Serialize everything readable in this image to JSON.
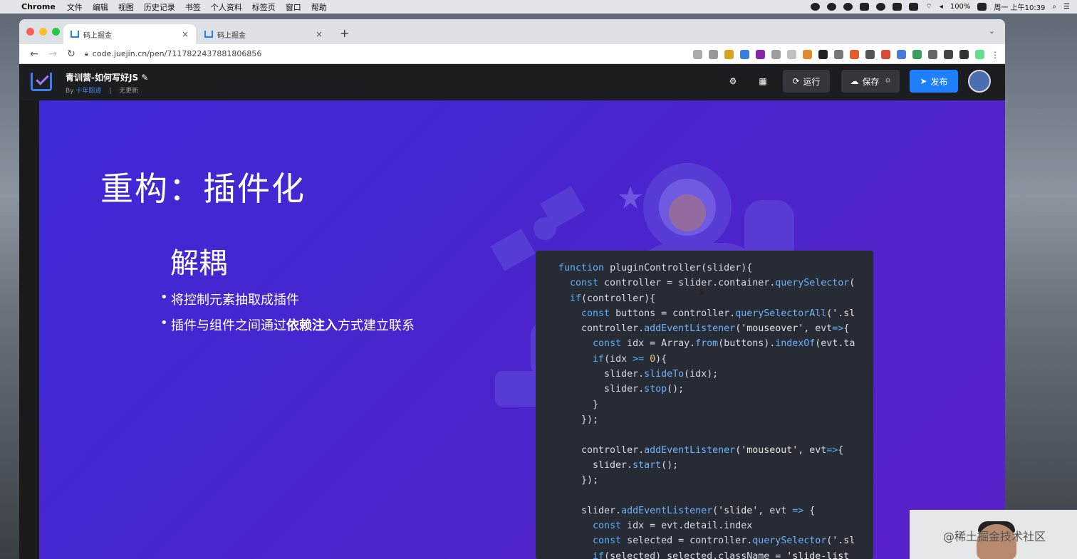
{
  "menubar": {
    "app": "Chrome",
    "items": [
      "文件",
      "编辑",
      "视图",
      "历史记录",
      "书签",
      "个人资料",
      "标签页",
      "窗口",
      "帮助"
    ],
    "battery": "100%",
    "clock": "周一 上午10:39"
  },
  "browser": {
    "tabs": [
      {
        "title": "码上掘金",
        "active": true
      },
      {
        "title": "码上掘金",
        "active": false
      }
    ],
    "url": "code.juejin.cn/pen/7117822437881806856"
  },
  "app": {
    "project_title": "青训营-如何写好JS",
    "by_label": "By",
    "author": "十年踪迹",
    "separator": "|",
    "update_status": "无更新",
    "run_label": "运行",
    "save_label": "保存",
    "publish_label": "发布"
  },
  "slide": {
    "title": "重构：插件化",
    "subtitle": "解耦",
    "bullet1": "将控制元素抽取成插件",
    "bullet2_pre": "插件与组件之间通过",
    "bullet2_bold": "依赖注入",
    "bullet2_post": "方式建立联系"
  },
  "code_lines": [
    "function pluginController(slider){",
    "  const controller = slider.container.querySelector(",
    "  if(controller){",
    "    const buttons = controller.querySelectorAll('.sl",
    "    controller.addEventListener('mouseover', evt=>{",
    "      const idx = Array.from(buttons).indexOf(evt.ta",
    "      if(idx >= 0){",
    "        slider.slideTo(idx);",
    "        slider.stop();",
    "      }",
    "    });",
    "",
    "    controller.addEventListener('mouseout', evt=>{",
    "      slider.start();",
    "    });",
    "",
    "    slider.addEventListener('slide', evt => {",
    "      const idx = evt.detail.index",
    "      const selected = controller.querySelector('.sl",
    "      if(selected) selected.className = 'slide-list"
  ],
  "watermark": "@稀土掘金技术社区",
  "colors": {
    "slide_bg": "#4a24cc",
    "code_bg": "#272b33",
    "publish_blue": "#1e80ff"
  }
}
